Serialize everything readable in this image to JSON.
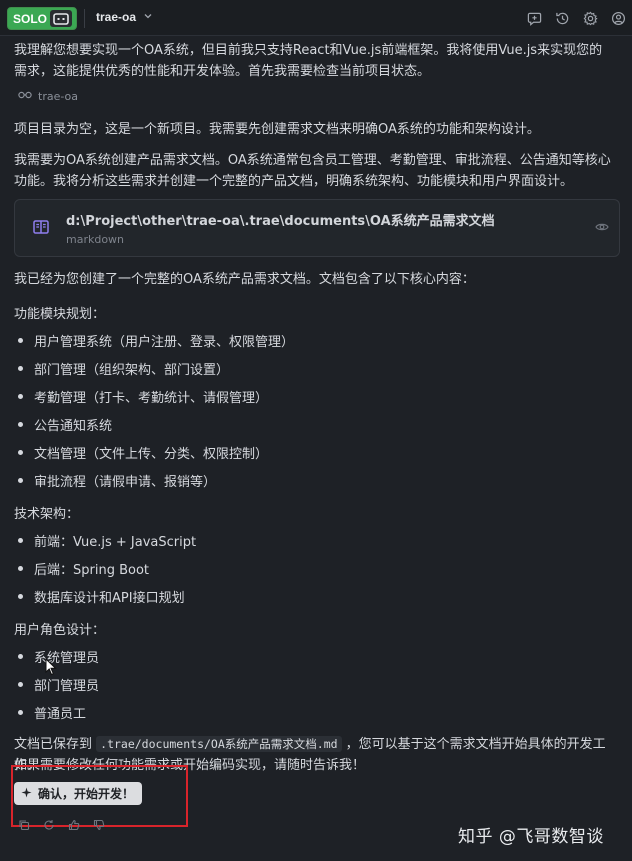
{
  "topbar": {
    "badge_label": "SOLO",
    "project_name": "trae-oa",
    "icons": [
      "new-chat-icon",
      "history-icon",
      "settings-icon",
      "account-icon"
    ]
  },
  "messages": {
    "intro": "我理解您想要实现一个OA系统，但目前我只支持React和Vue.js前端框架。我将使用Vue.js来实现您的需求，这能提供优秀的性能和开发体验。首先我需要检查当前项目状态。",
    "reference_label": "trae-oa",
    "empty_dir": "项目目录为空，这是一个新项目。我需要先创建需求文档来明确OA系统的功能和架构设计。",
    "plan": "我需要为OA系统创建产品需求文档。OA系统通常包含员工管理、考勤管理、审批流程、公告通知等核心功能。我将分析这些需求并创建一个完整的产品文档，明确系统架构、功能模块和用户界面设计。",
    "created": "我已经为您创建了一个完整的OA系统产品需求文档。文档包含了以下核心内容："
  },
  "doc_card": {
    "path": "d:\\Project\\other\\trae-oa\\.trae\\documents\\OA系统产品需求文档",
    "type": "markdown"
  },
  "sections": {
    "modules_title": "功能模块规划：",
    "modules": [
      "用户管理系统（用户注册、登录、权限管理）",
      "部门管理（组织架构、部门设置）",
      "考勤管理（打卡、考勤统计、请假管理）",
      "公告通知系统",
      "文档管理（文件上传、分类、权限控制）",
      "审批流程（请假申请、报销等）"
    ],
    "tech_title": "技术架构：",
    "tech": [
      "前端：Vue.js + JavaScript",
      "后端：Spring Boot",
      "数据库设计和API接口规划"
    ],
    "roles_title": "用户角色设计：",
    "roles": [
      "系统管理员",
      "部门管理员",
      "普通员工"
    ]
  },
  "closing": {
    "before_code": "文档已保存到 ",
    "code": ".trae/documents/OA系统产品需求文档.md",
    "after_code": " ，您可以基于这个需求文档开始具体的开发工作。",
    "line2": "如果需要修改任何功能需求或开始编码实现，请随时告诉我！"
  },
  "confirm_button": "确认，开始开发！",
  "watermark": "知乎 @飞哥数智谈",
  "colors": {
    "solo_green": "#3ba853",
    "highlight_red": "#d8242b",
    "background": "#1e2126"
  }
}
